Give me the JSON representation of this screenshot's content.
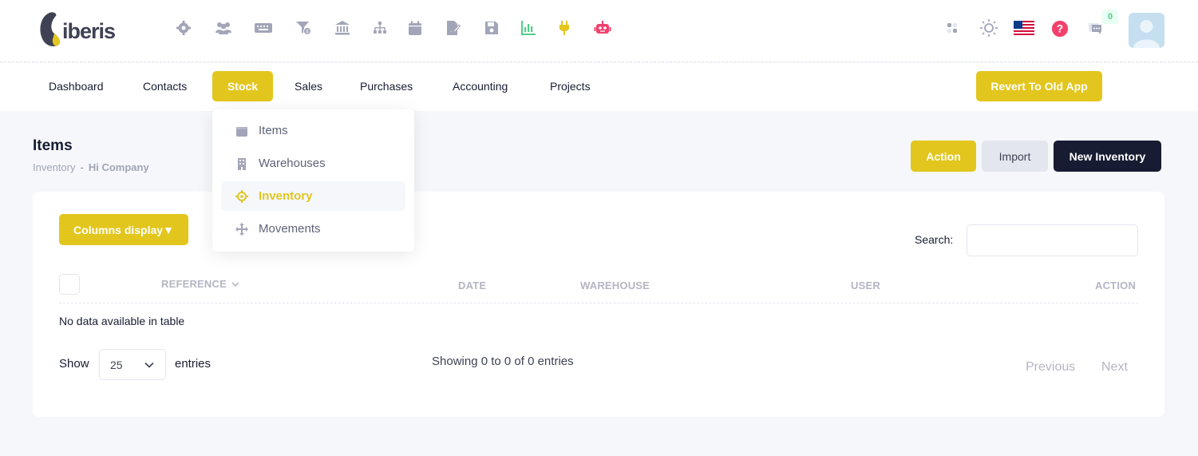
{
  "app": {
    "logo_text": "iberis"
  },
  "topbar": {
    "icons": [
      "gear-icon",
      "users-icon",
      "keyboard-icon",
      "funnel-dollar-icon",
      "bank-icon",
      "sitemap-icon",
      "calendar-icon",
      "file-signature-icon",
      "save-icon",
      "chart-bar-icon",
      "plug-icon",
      "robot-icon"
    ],
    "right_icons": [
      "apps-icon",
      "theme-sun-icon",
      "us-flag-icon",
      "help-icon",
      "chat-icon",
      "user-avatar"
    ],
    "notifications_count": "0",
    "colors": {
      "chart": "#50cd89",
      "plug": "#e3c61d",
      "robot": "#f1416c",
      "help": "#f1416c",
      "badge_bg": "#e8fff3",
      "badge_text": "#50cd89"
    }
  },
  "nav": {
    "items": [
      "Dashboard",
      "Contacts",
      "Stock",
      "Sales",
      "Purchases",
      "Accounting",
      "Projects"
    ],
    "active": "Stock",
    "revert_label": "Revert To Old App"
  },
  "dropdown": {
    "items": [
      {
        "label": "Items",
        "icon": "box-icon"
      },
      {
        "label": "Warehouses",
        "icon": "building-icon"
      },
      {
        "label": "Inventory",
        "icon": "crosshair-icon"
      },
      {
        "label": "Movements",
        "icon": "arrows-move-icon"
      }
    ],
    "active": "Inventory"
  },
  "page": {
    "title": "Items",
    "breadcrumb": [
      "Inventory",
      "-",
      "Hi Company"
    ]
  },
  "actions": {
    "action": "Action",
    "import": "Import",
    "new_inventory": "New Inventory"
  },
  "table": {
    "columns_display_label": "Columns display▼",
    "search_label": "Search:",
    "search_value": "",
    "headers": [
      "REFERENCE",
      "DATE",
      "WAREHOUSE",
      "USER",
      "ACTION"
    ],
    "empty_text": "No data available in table",
    "show_label": "Show",
    "page_size": "25",
    "entries_label": "entries",
    "info": "Showing 0 to 0 of 0 entries",
    "previous": "Previous",
    "next": "Next"
  },
  "theme": {
    "accent": "#e3c61d",
    "dark": "#181c32",
    "muted": "#b5b5c3"
  }
}
